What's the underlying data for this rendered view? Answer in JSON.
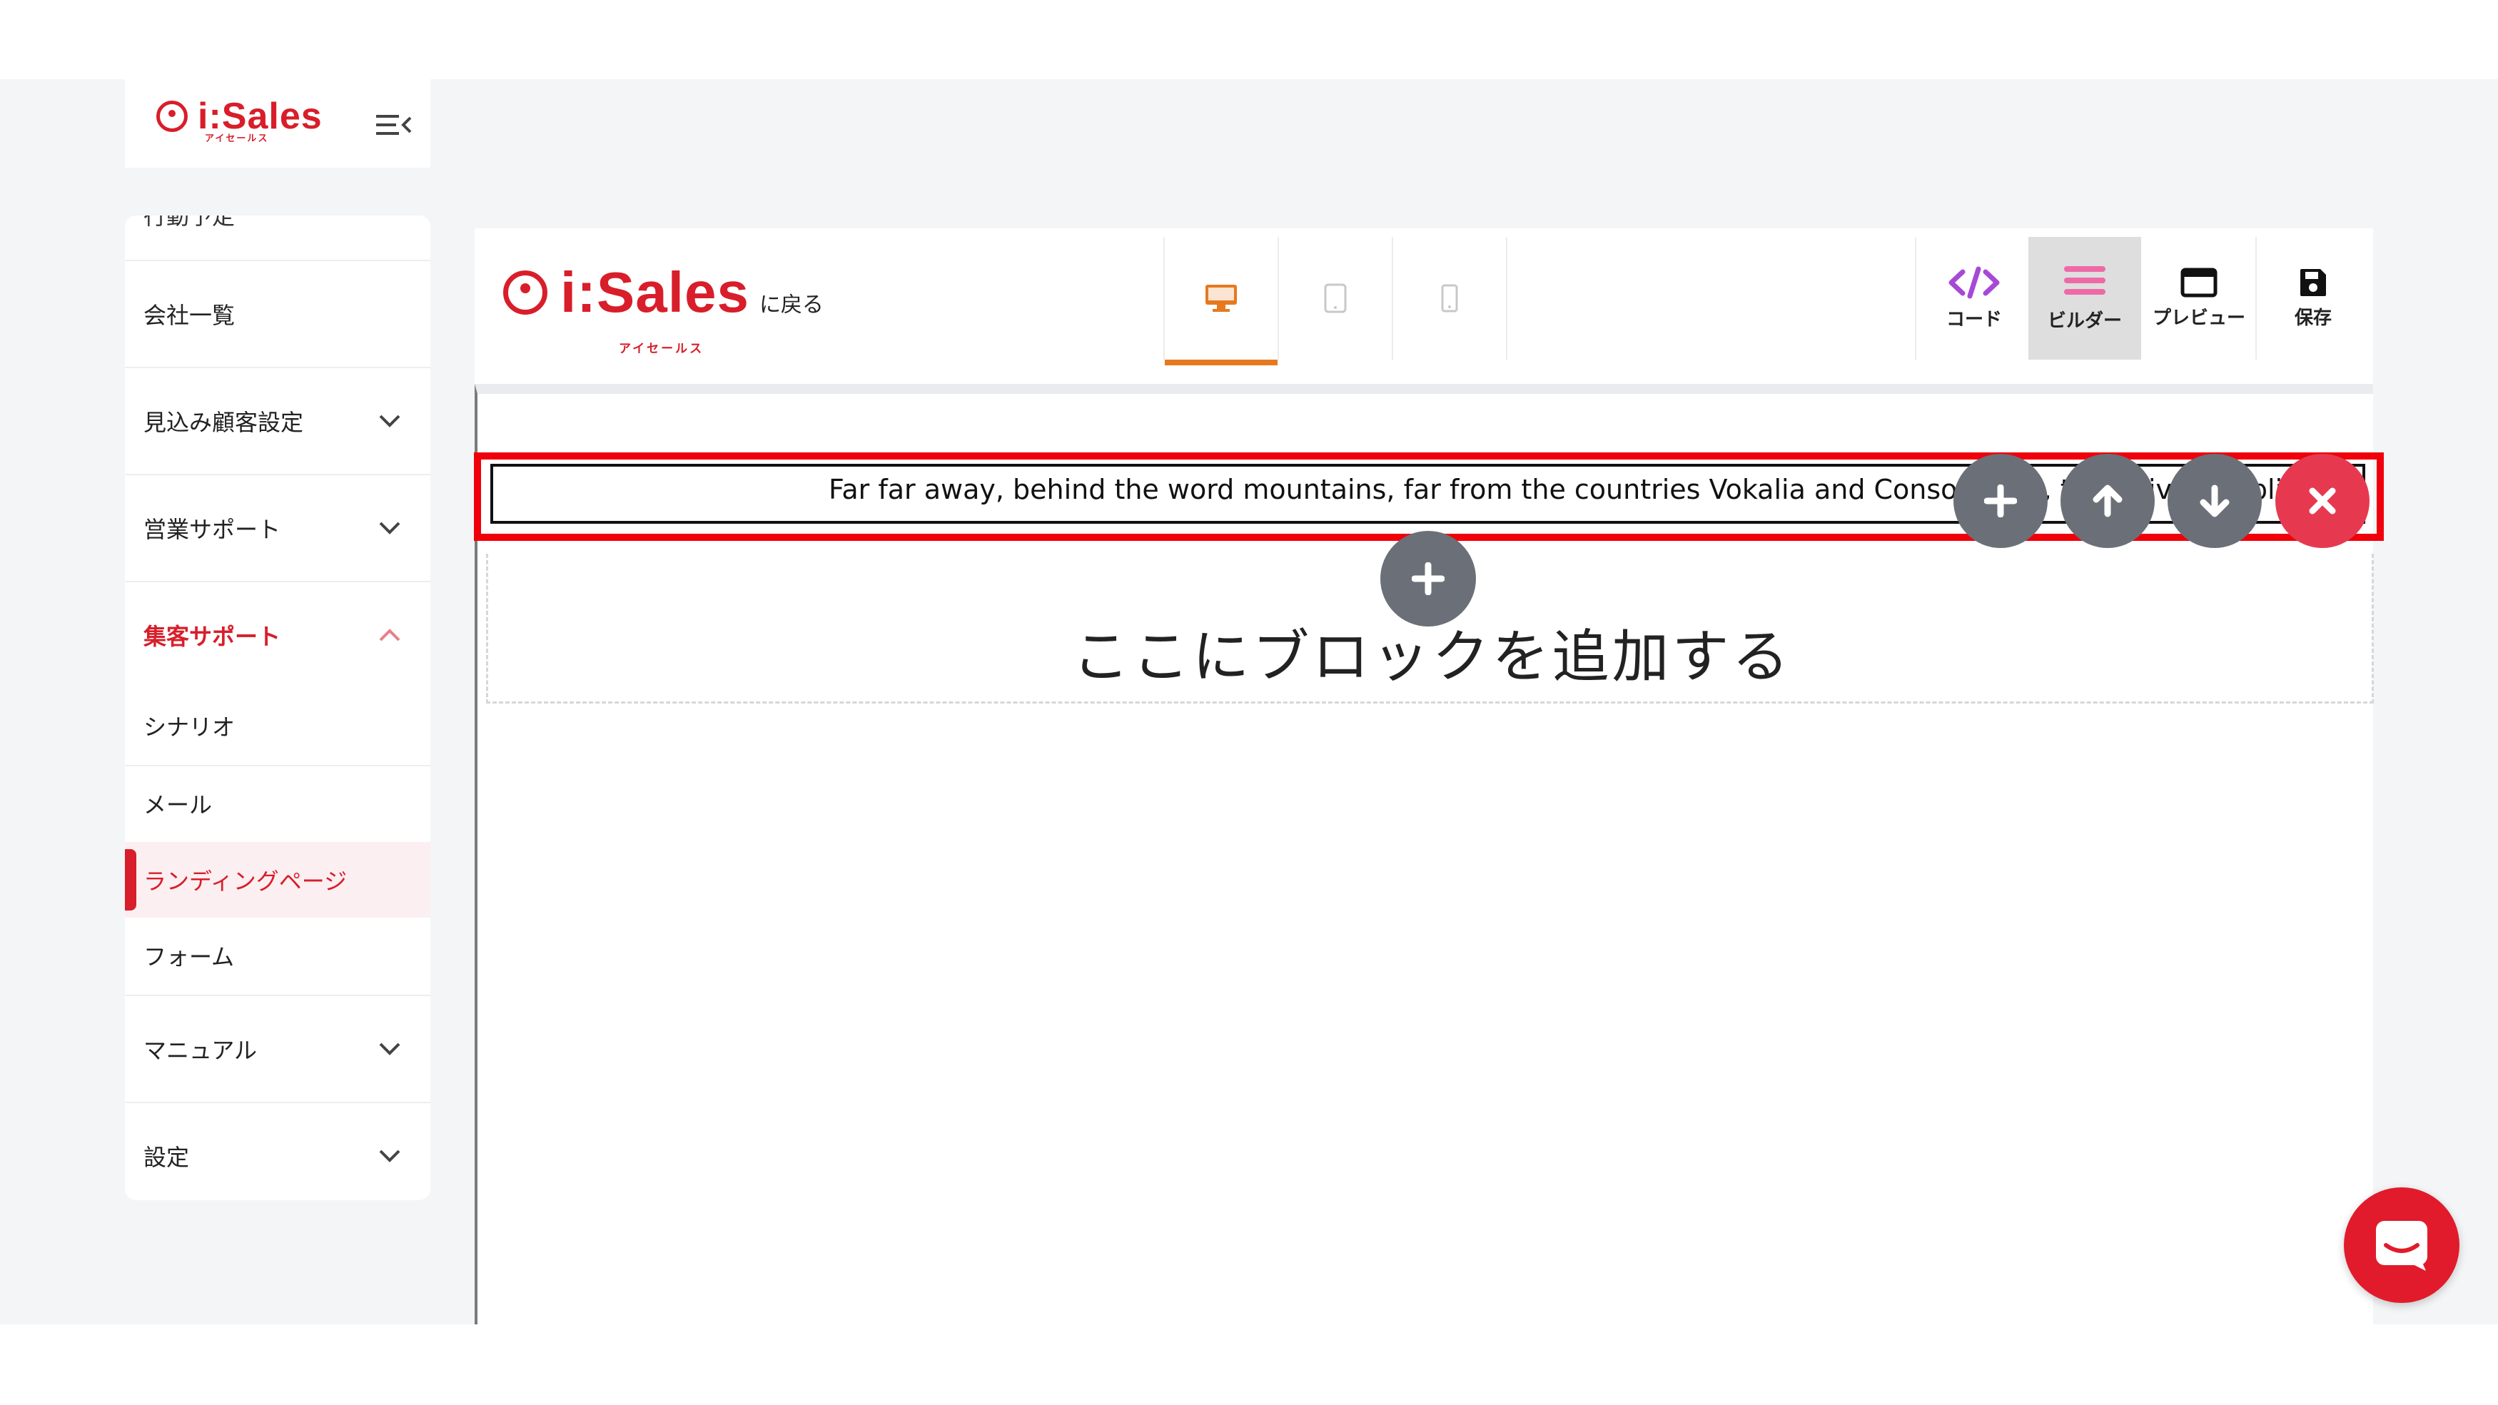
{
  "brand": {
    "name": "i:Sales",
    "sub": "アイセールス",
    "color": "#d81e2a"
  },
  "sidebar": {
    "partial_item": "行動予定",
    "items": [
      {
        "label": "会社一覧",
        "has_chevron": false
      },
      {
        "label": "見込み顧客設定",
        "has_chevron": true
      },
      {
        "label": "営業サポート",
        "has_chevron": true
      },
      {
        "label": "集客サポート",
        "has_chevron": true,
        "expanded": true
      }
    ],
    "sub_items": [
      {
        "label": "シナリオ"
      },
      {
        "label": "メール"
      },
      {
        "label": "ランディングページ",
        "active": true
      },
      {
        "label": "フォーム"
      }
    ],
    "bottom_items": [
      {
        "label": "マニュアル"
      },
      {
        "label": "設定"
      }
    ]
  },
  "editor": {
    "back_label": "に戻る",
    "devices": [
      {
        "name": "desktop-icon",
        "active": true
      },
      {
        "name": "tablet-icon",
        "active": false
      },
      {
        "name": "mobile-icon",
        "active": false
      }
    ],
    "tools": [
      {
        "label": "コード",
        "icon": "code-icon",
        "color": "#a64ad6"
      },
      {
        "label": "ビルダー",
        "icon": "builder-icon",
        "color": "#ee6aa7",
        "active": true
      },
      {
        "label": "プレビュー",
        "icon": "preview-icon"
      },
      {
        "label": "保存",
        "icon": "save-icon"
      }
    ],
    "block_text": "Far far away, behind the word mountains, far from the countries Vokalia and Consonantia, there live the blind texts.",
    "add_block_label": "ここにブロックを追加する",
    "highlight_color": "#f0000a"
  }
}
